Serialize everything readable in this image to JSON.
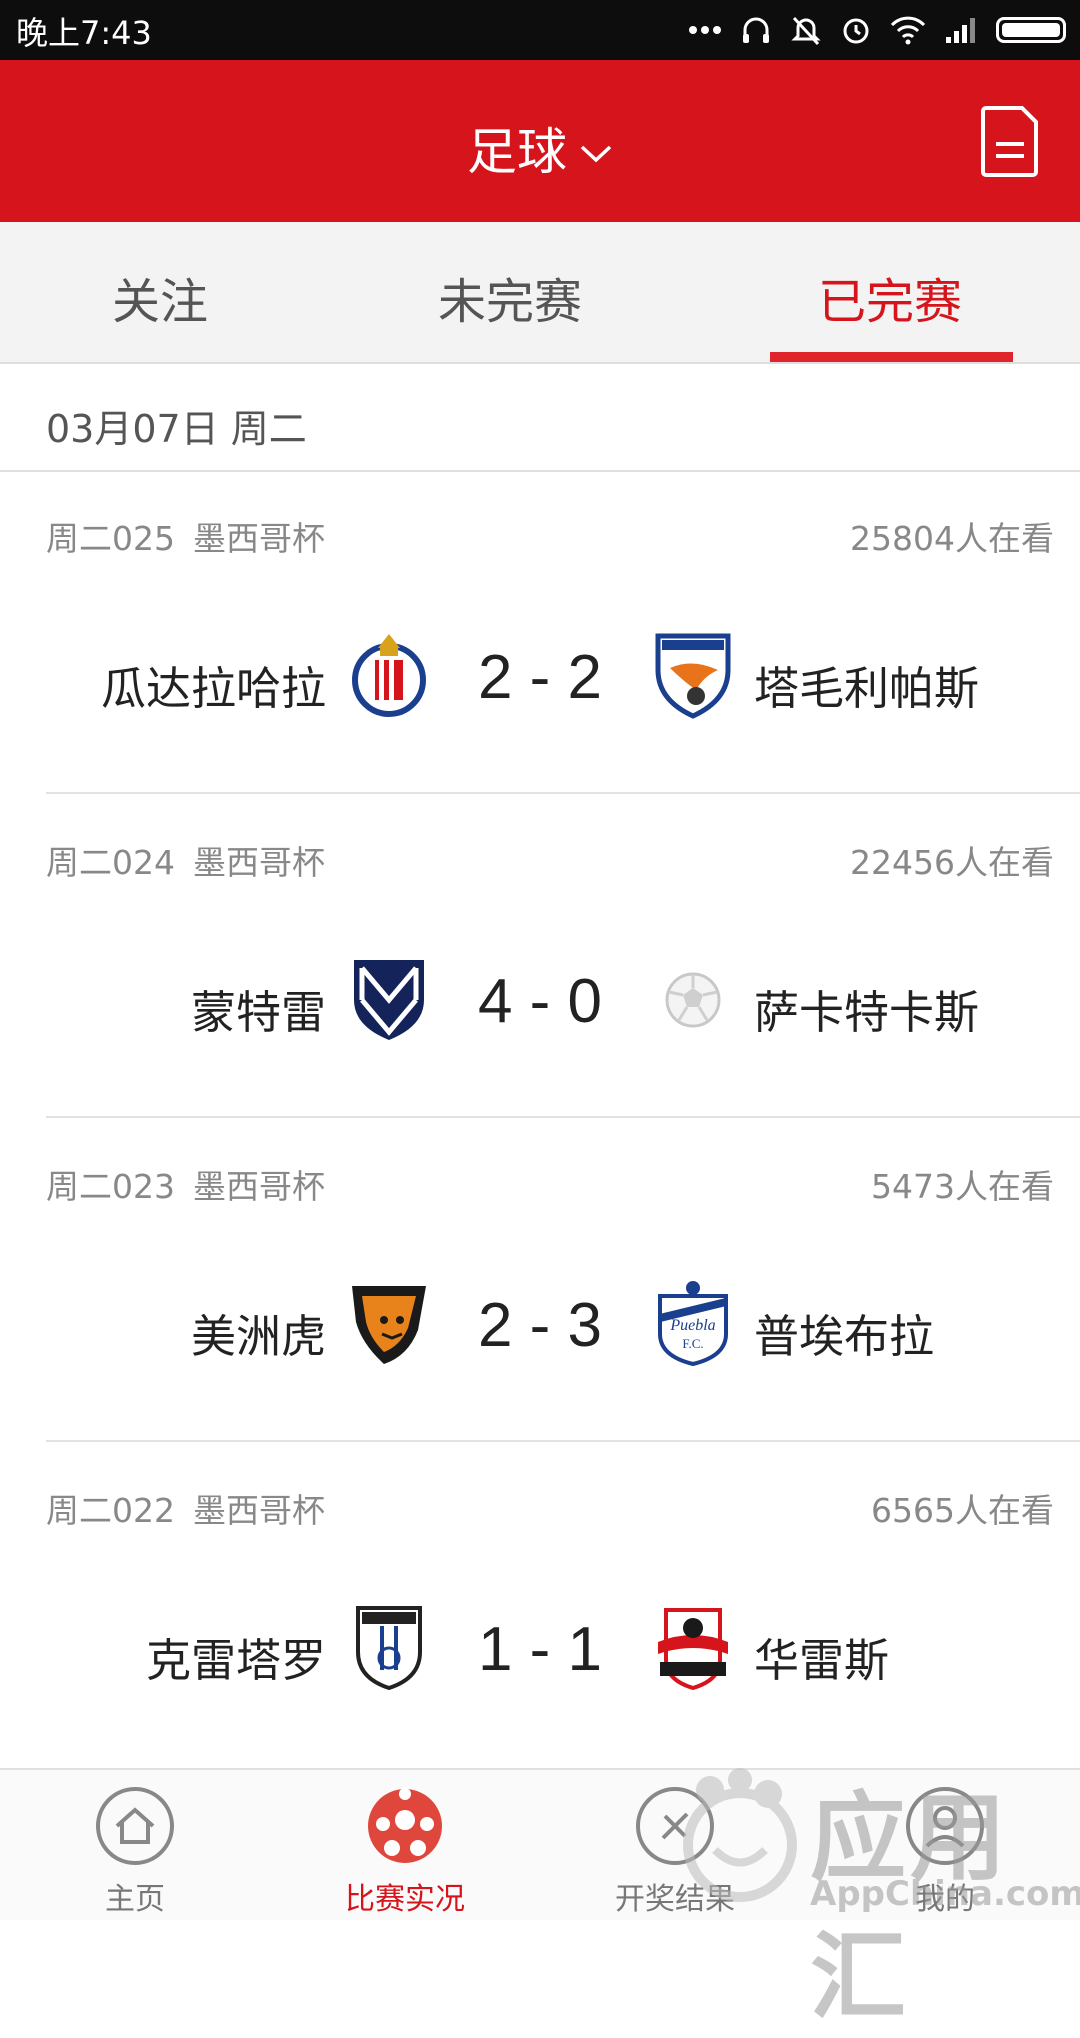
{
  "status_bar": {
    "time": "晚上7:43"
  },
  "header": {
    "title": "足球"
  },
  "tabs": [
    {
      "label": "关注",
      "active": false
    },
    {
      "label": "未完赛",
      "active": false
    },
    {
      "label": "已完赛",
      "active": true
    }
  ],
  "date_header": "03月07日 周二",
  "matches": [
    {
      "code": "周二025",
      "league": "墨西哥杯",
      "viewers": "25804人在看",
      "home": "瓜达拉哈拉",
      "away": "塔毛利帕斯",
      "score": "2 - 2",
      "home_logo": "chivas-crest-icon",
      "away_logo": "correcaminos-crest-icon"
    },
    {
      "code": "周二024",
      "league": "墨西哥杯",
      "viewers": "22456人在看",
      "home": "蒙特雷",
      "away": "萨卡特卡斯",
      "score": "4 - 0",
      "home_logo": "monterrey-crest-icon",
      "away_logo": "soccer-ball-placeholder-icon"
    },
    {
      "code": "周二023",
      "league": "墨西哥杯",
      "viewers": "5473人在看",
      "home": "美洲虎",
      "away": "普埃布拉",
      "score": "2 - 3",
      "home_logo": "jaguares-crest-icon",
      "away_logo": "puebla-crest-icon"
    },
    {
      "code": "周二022",
      "league": "墨西哥杯",
      "viewers": "6565人在看",
      "home": "克雷塔罗",
      "away": "华雷斯",
      "score": "1 - 1",
      "home_logo": "queretaro-crest-icon",
      "away_logo": "indios-crest-icon"
    }
  ],
  "bottom_nav": [
    {
      "label": "主页",
      "icon": "home-icon",
      "active": false
    },
    {
      "label": "比赛实况",
      "icon": "soccer-ball-icon",
      "active": true
    },
    {
      "label": "开奖结果",
      "icon": "lottery-result-icon",
      "active": false
    },
    {
      "label": "我的",
      "icon": "profile-icon",
      "active": false
    }
  ],
  "watermark": {
    "text": "应用汇",
    "subtext": "AppChina.com"
  },
  "colors": {
    "brand_red": "#d5141b",
    "text_dark": "#222222",
    "text_muted": "#888888"
  }
}
